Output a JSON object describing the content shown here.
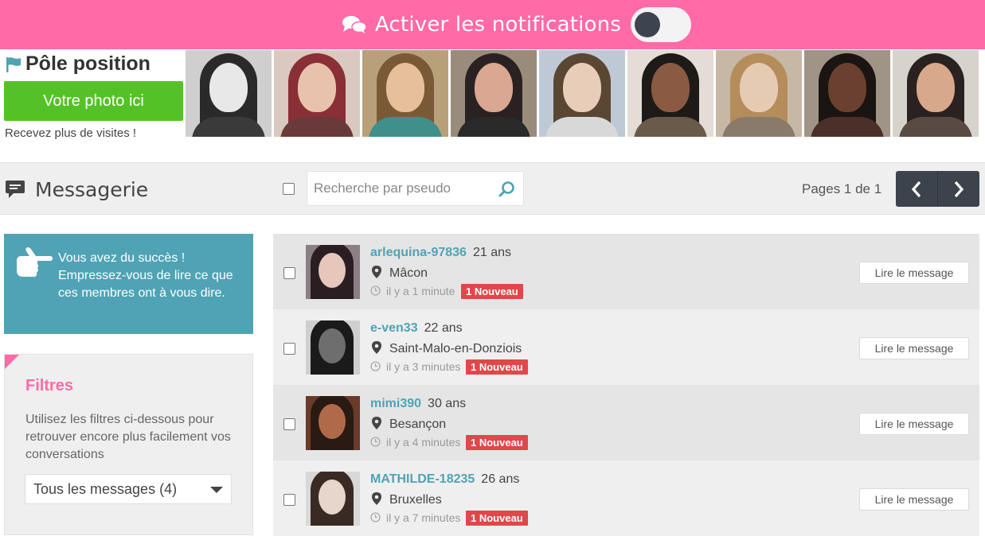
{
  "notification_bar": {
    "label": "Activer les notifications",
    "toggle_on": false,
    "color": "#ff6aa7"
  },
  "pole_position": {
    "title": "Pôle position",
    "photo_button": "Votre photo ici",
    "subtitle": "Recevez plus de visites !",
    "thumb_count": 9
  },
  "header": {
    "title": "Messagerie",
    "search_placeholder": "Recherche par pseudo",
    "pages_label": "Pages 1 de 1"
  },
  "success_box": {
    "text": "Vous avez du succès ! Empressez-vous de lire ce que ces membres ont à vous dire."
  },
  "filters": {
    "title": "Filtres",
    "description": "Utilisez les filtres ci-dessous pour retrouver encore plus facilement vos conversations",
    "selected": "Tous les messages (4)"
  },
  "messages": [
    {
      "username": "arlequina-97836",
      "age": "21 ans",
      "city": "Mâcon",
      "time": "il y a 1 minute",
      "badge": "1 Nouveau",
      "button": "Lire le message"
    },
    {
      "username": "e-ven33",
      "age": "22 ans",
      "city": "Saint-Malo-en-Donziois",
      "time": "il y a 3 minutes",
      "badge": "1 Nouveau",
      "button": "Lire le message"
    },
    {
      "username": "mimi390",
      "age": "30 ans",
      "city": "Besançon",
      "time": "il y a 4 minutes",
      "badge": "1 Nouveau",
      "button": "Lire le message"
    },
    {
      "username": "MATHILDE-18235",
      "age": "26 ans",
      "city": "Bruxelles",
      "time": "il y a 7 minutes",
      "badge": "1 Nouveau",
      "button": "Lire le message"
    }
  ],
  "colors": {
    "accent_pink": "#ff6aa7",
    "teal": "#4fa3b5",
    "green": "#54c226",
    "badge_red": "#e0474a",
    "pager": "#3c434d"
  }
}
